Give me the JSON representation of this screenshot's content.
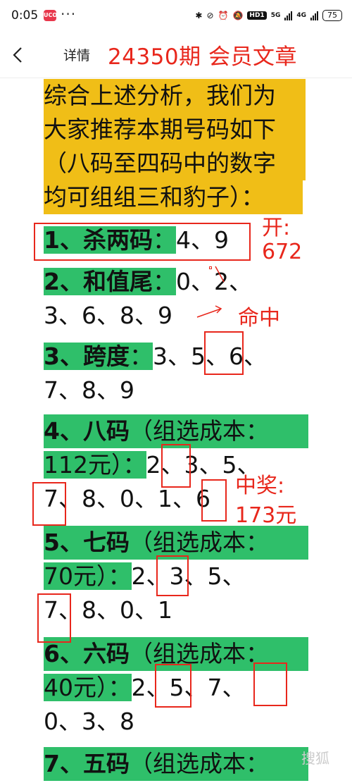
{
  "status": {
    "time": "0:05",
    "app_badge": "UCO",
    "dots": "···",
    "hd": "HD1",
    "net1": "5G",
    "net2": "4G",
    "battery": "75"
  },
  "nav": {
    "title": "详情",
    "overlay": "24350期 会员文章"
  },
  "article": {
    "intro": [
      "综合上述分析，我们为",
      "大家推荐本期号码如下",
      "（八码至四码中的数字",
      "均可组组三和豹子）："
    ],
    "s1": {
      "label": "1、杀两码",
      "colon": "：",
      "numbers": "4、9"
    },
    "s2": {
      "label": "2、和值尾",
      "colon": "：",
      "line1": "0、2、",
      "line2": "3、6、8、9"
    },
    "s3": {
      "label": "3、跨度",
      "colon": "：",
      "line1": "3、5、6、",
      "line2": "7、8、9"
    },
    "s4": {
      "label": "4、八码",
      "note": "（组选成本：",
      "cost": "112元）",
      "colon": "：",
      "line2": "2、3、5、",
      "line3": "7、8、0、1、6"
    },
    "s5": {
      "label": "5、七码",
      "note": "（组选成本：",
      "cost": "70元）",
      "colon": "：",
      "line2": "2、3、5、",
      "line3": "7、8、0、1"
    },
    "s6": {
      "label": "6、六码",
      "note": "（组选成本：",
      "cost": "40元）",
      "colon": "：",
      "line2": "2、5、7、",
      "line3": "0、3、8"
    },
    "s7": {
      "label": "7、五码",
      "note": "（组选成本："
    }
  },
  "annotations": {
    "open_label": "开:",
    "open_value": "672",
    "hit": "命中",
    "prize_label": "中奖:",
    "prize_value": "173元"
  },
  "watermark": "搜狐"
}
